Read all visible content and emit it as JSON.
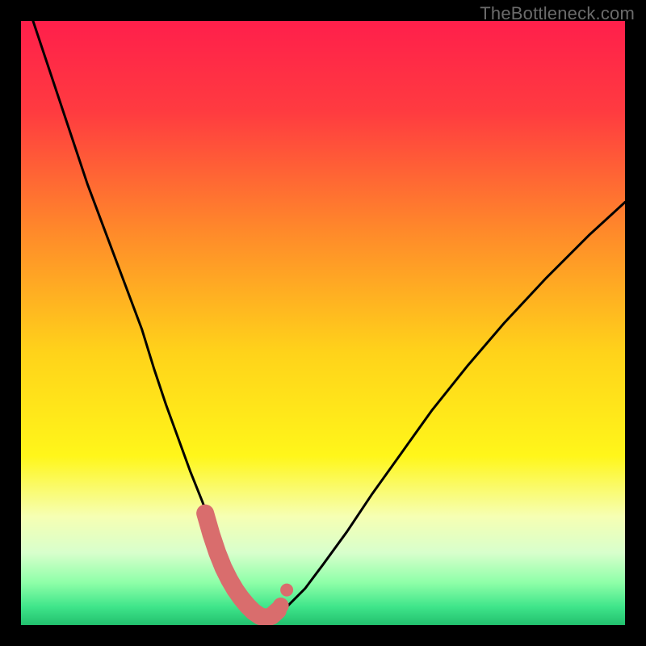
{
  "watermark": "TheBottleneck.com",
  "chart_data": {
    "type": "line",
    "title": "",
    "xlabel": "",
    "ylabel": "",
    "xlim": [
      0,
      100
    ],
    "ylim": [
      0,
      100
    ],
    "grid": false,
    "background": "heatmap-gradient",
    "series": [
      {
        "name": "bottleneck-curve",
        "color": "#000000",
        "x": [
          2,
          5,
          8,
          11,
          14,
          17,
          20,
          22,
          24,
          26,
          28,
          30,
          31.5,
          33,
          34,
          35,
          36,
          37,
          38,
          40,
          42,
          44,
          47,
          50,
          54,
          58,
          63,
          68,
          74,
          80,
          87,
          94,
          100
        ],
        "values": [
          100,
          91,
          82,
          73,
          65,
          57,
          49,
          42.5,
          36.5,
          31,
          25.5,
          20.5,
          16.5,
          12.5,
          9.5,
          7.0,
          5.0,
          3.4,
          2.2,
          1.0,
          1.5,
          3.0,
          6.0,
          10.0,
          15.5,
          21.5,
          28.5,
          35.5,
          43.0,
          50.0,
          57.5,
          64.5,
          70.0
        ]
      }
    ],
    "highlight_points": {
      "name": "marker-cluster",
      "color": "#d96d6d",
      "x": [
        30.5,
        31.5,
        32.5,
        33.5,
        34.5,
        35.5,
        36.5,
        37.5,
        38.5,
        39.5,
        40.5,
        41.5,
        42.5,
        43.0,
        44.0
      ],
      "values": [
        18.5,
        15.0,
        12.0,
        9.5,
        7.5,
        5.8,
        4.4,
        3.2,
        2.2,
        1.5,
        1.2,
        1.5,
        2.4,
        3.2,
        5.8
      ]
    },
    "gradient_stops": [
      {
        "offset": 0.0,
        "color": "#ff1f4b"
      },
      {
        "offset": 0.15,
        "color": "#ff3b40"
      },
      {
        "offset": 0.35,
        "color": "#ff8a2a"
      },
      {
        "offset": 0.55,
        "color": "#ffd31a"
      },
      {
        "offset": 0.72,
        "color": "#fff61a"
      },
      {
        "offset": 0.82,
        "color": "#f6ffb3"
      },
      {
        "offset": 0.88,
        "color": "#d8ffcc"
      },
      {
        "offset": 0.93,
        "color": "#8effa8"
      },
      {
        "offset": 0.97,
        "color": "#3fe58a"
      },
      {
        "offset": 1.0,
        "color": "#22c06e"
      }
    ]
  }
}
